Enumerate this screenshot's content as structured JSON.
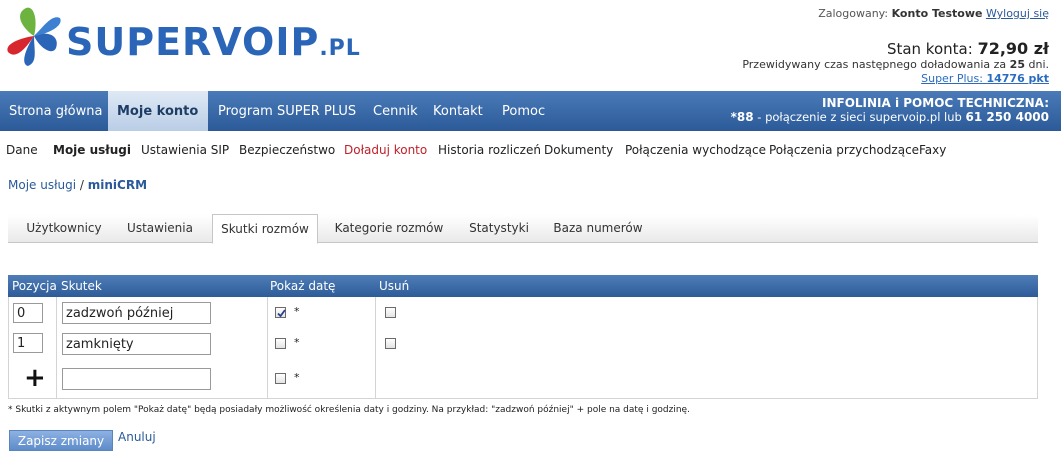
{
  "header": {
    "logged_label": "Zalogowany:",
    "user_name": "Konto Testowe",
    "logout_label": "Wyloguj się",
    "balance_label": "Stan konta:",
    "balance_value": "72,90 zł",
    "recharge_text": "Przewidywany czas następnego doładowania za",
    "recharge_days": "25",
    "recharge_unit": "dni.",
    "superplus_label": "Super Plus:",
    "superplus_value": "14776 pkt"
  },
  "brand": {
    "name": "SUPERVOIP",
    "suffix": ".PL",
    "colors": {
      "blue": "#2a65b8",
      "green": "#6cb33f",
      "red": "#d8262f"
    }
  },
  "mainnav": {
    "items": [
      {
        "label": "Strona główna"
      },
      {
        "label": "Moje konto"
      },
      {
        "label": "Program SUPER PLUS"
      },
      {
        "label": "Cennik"
      },
      {
        "label": "Kontakt"
      },
      {
        "label": "Pomoc"
      }
    ],
    "active_index": 1,
    "infolinia_title": "INFOLINIA i POMOC TECHNICZNA:",
    "infolinia_short": "*88",
    "infolinia_middle": "- połączenie z sieci supervoip.pl lub",
    "infolinia_phone": "61 250 4000"
  },
  "subnav": {
    "items": [
      {
        "label": "Dane"
      },
      {
        "label": "Moje usługi"
      },
      {
        "label": "Ustawienia SIP"
      },
      {
        "label": "Bezpieczeństwo"
      },
      {
        "label": "Doładuj konto"
      },
      {
        "label": "Historia rozliczeń"
      },
      {
        "label": "Dokumenty"
      },
      {
        "label": "Połączenia wychodzące"
      },
      {
        "label": "Połączenia przychodzące"
      },
      {
        "label": "Faxy"
      }
    ]
  },
  "breadcrumb": {
    "parent": "Moje usługi",
    "separator": "/",
    "current": "miniCRM"
  },
  "tabs": {
    "items": [
      {
        "label": "Użytkownicy"
      },
      {
        "label": "Ustawienia"
      },
      {
        "label": "Skutki rozmów"
      },
      {
        "label": "Kategorie rozmów"
      },
      {
        "label": "Statystyki"
      },
      {
        "label": "Baza numerów"
      }
    ],
    "active_index": 2
  },
  "table": {
    "headers": {
      "position": "Pozycja",
      "result": "Skutek",
      "show_date": "Pokaż datę",
      "delete": "Usuń"
    },
    "rows": [
      {
        "position": "0",
        "result": "zadzwoń później",
        "show_date": true,
        "delete": false
      },
      {
        "position": "1",
        "result": "zamknięty",
        "show_date": false,
        "delete": false
      }
    ],
    "new_row": {
      "add_symbol": "+",
      "result": "",
      "show_date": false
    },
    "asterisk": "*"
  },
  "note": "* Skutki z aktywnym polem \"Pokaż datę\" będą posiadały możliwość określenia daty i godziny. Na przykład: \"zadzwoń później\" + pole na datę i godzinę.",
  "actions": {
    "save_label": "Zapisz zmiany",
    "cancel_label": "Anuluj"
  }
}
